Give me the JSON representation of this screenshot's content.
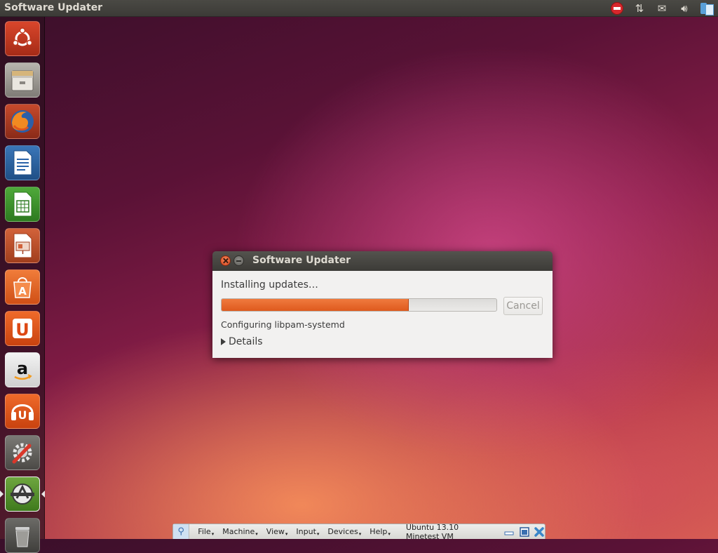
{
  "top_panel": {
    "title": "Software Updater",
    "tray_icons": [
      "stop-icon",
      "network-icon",
      "mail-icon",
      "volume-icon",
      "updates-icon"
    ]
  },
  "launcher": {
    "items": [
      {
        "name": "dash-home",
        "icon": "ubuntu-logo-icon"
      },
      {
        "name": "files",
        "icon": "file-cabinet-icon"
      },
      {
        "name": "firefox",
        "icon": "firefox-icon"
      },
      {
        "name": "libreoffice-writer",
        "icon": "writer-icon"
      },
      {
        "name": "libreoffice-calc",
        "icon": "calc-icon"
      },
      {
        "name": "libreoffice-impress",
        "icon": "impress-icon"
      },
      {
        "name": "ubuntu-software-center",
        "icon": "software-center-icon"
      },
      {
        "name": "ubuntu-one",
        "icon": "ubuntu-one-icon"
      },
      {
        "name": "amazon",
        "icon": "amazon-icon"
      },
      {
        "name": "ubuntu-one-music",
        "icon": "ubuntu-one-music-icon"
      },
      {
        "name": "system-settings",
        "icon": "settings-icon"
      },
      {
        "name": "software-updater",
        "icon": "software-updater-icon"
      },
      {
        "name": "trash",
        "icon": "trash-icon"
      }
    ]
  },
  "dialog": {
    "title": "Software Updater",
    "status": "Installing updates…",
    "progress": 0.68,
    "cancel_label": "Cancel",
    "activity": "Configuring libpam-systemd",
    "details_label": "Details"
  },
  "vbox_bar": {
    "menus": [
      "File",
      "Machine",
      "View",
      "Input",
      "Devices",
      "Help"
    ],
    "vm_name": "Ubuntu 13.10 Minetest VM"
  },
  "colors": {
    "accent_orange": "#dd4814",
    "panel_dark": "#3c3b37",
    "dialog_bg": "#f2f1f0"
  }
}
